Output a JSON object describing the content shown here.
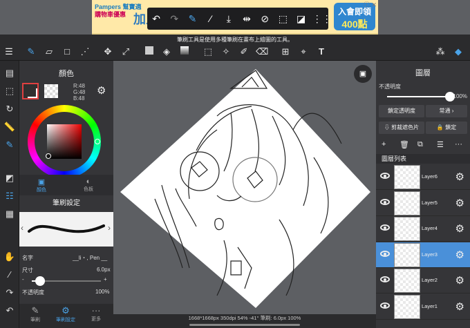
{
  "ad": {
    "brand": "Pampers 幫寶適",
    "sub": "購物車優惠",
    "headline": "加入購物車送點",
    "badge_line1": "入會即領",
    "badge_line2": "400點",
    "close": "ⓘ ✕"
  },
  "tooltip": "筆刷工具是使用多種筆刷在畫布上繪圖的工具。",
  "left_panel": {
    "color_title": "顏色",
    "rgb": [
      "R:48",
      "G:48",
      "B:48"
    ],
    "tab_color": "顏色",
    "tab_palette": "色板",
    "brush_title": "筆刷設定",
    "name_label": "名字",
    "name_value": "__li・, Pen __",
    "size_label": "尺寸",
    "size_value": "6.0px",
    "size_fraction": 0.12,
    "opacity_label": "不透明度",
    "opacity_value": "100%",
    "bottom_tabs": [
      "筆刷",
      "筆刷設定",
      "更多"
    ]
  },
  "status": "1668*1668px 350dpi 54% -41° 筆刷: 6.0px 100%",
  "layers_panel": {
    "title": "圖層",
    "opacity_label": "不透明度",
    "opacity_value": "100%",
    "opacity_fraction": 1.0,
    "lock_alpha": "鎖定透明度",
    "blend_mode": "常通",
    "clipping": "剪裁遮色片",
    "lock": "鎖定",
    "list_title": "圖層列表",
    "layers": [
      {
        "name": "Layer6",
        "selected": false
      },
      {
        "name": "Layer5",
        "selected": false
      },
      {
        "name": "Layer4",
        "selected": false
      },
      {
        "name": "Layer3",
        "selected": true
      },
      {
        "name": "Layer2",
        "selected": false
      },
      {
        "name": "Layer1",
        "selected": false
      }
    ]
  },
  "colors": {
    "accent": "#4a90d9",
    "panel": "#353538",
    "canvas_bg": "#5d5f63"
  }
}
